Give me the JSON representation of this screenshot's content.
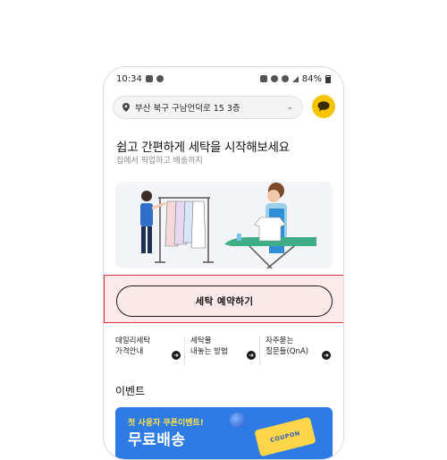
{
  "status_bar": {
    "time": "10:34",
    "battery": "84%"
  },
  "header": {
    "address": "부산 북구 구남언덕로 15 3층",
    "location_icon": "location-pin-icon",
    "dropdown_icon": "chevron-down-icon",
    "chat_icon": "chat-bubble-icon",
    "chat_color": "#f6c400"
  },
  "hero": {
    "title": "쉽고 간편하게 세탁을 시작해보세요",
    "subtitle": "집에서 픽업하고 배송까지"
  },
  "cta": {
    "label": "세탁 예약하기",
    "highlight_color": "#e0303a"
  },
  "quick_links": [
    {
      "line1": "데일리세탁",
      "line2": "가격안내"
    },
    {
      "line1": "세탁물",
      "line2": "내놓는 방법"
    },
    {
      "line1": "자주묻는",
      "line2": "질문들(QnA)"
    }
  ],
  "events": {
    "title": "이벤트",
    "banner_tag": "첫 사용자 쿠폰이벤트!",
    "banner_main": "무료배송",
    "coupon_text": "COUPON",
    "banner_color": "#2e7be6"
  }
}
